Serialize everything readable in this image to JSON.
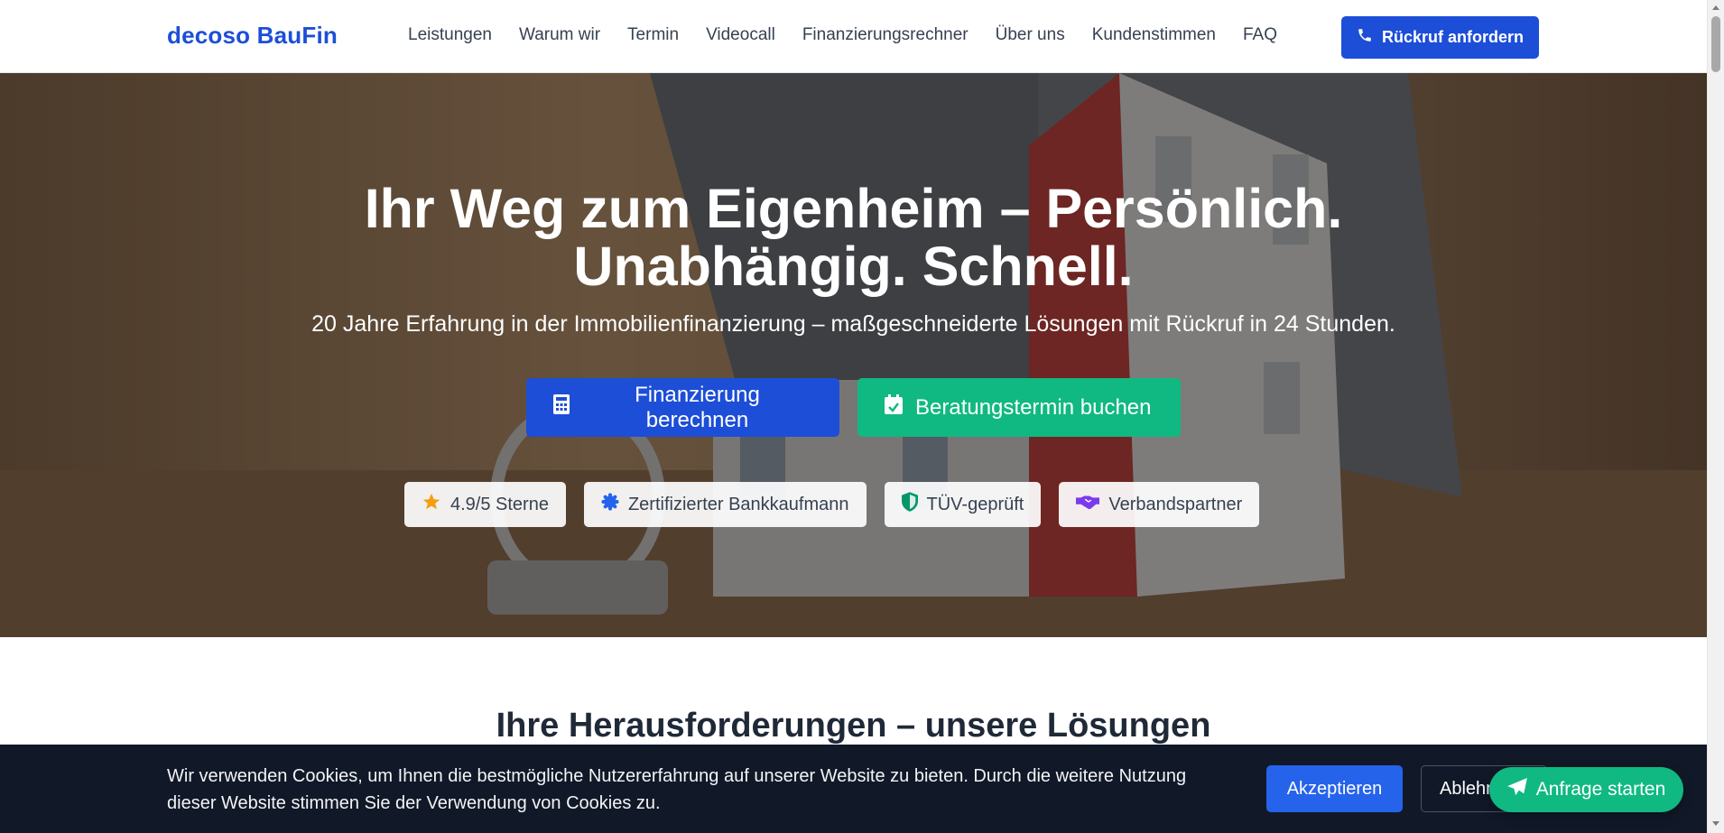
{
  "header": {
    "logo": "decoso BauFin",
    "nav": [
      "Leistungen",
      "Warum wir",
      "Termin",
      "Videocall",
      "Finanzierungsrechner",
      "Über uns",
      "Kundenstimmen",
      "FAQ"
    ],
    "callback_label": "Rückruf anfordern",
    "callback_icon": "phone-icon"
  },
  "hero": {
    "title_line1": "Ihr Weg zum Eigenheim – Persönlich.",
    "title_line2": "Unabhängig. Schnell.",
    "subtitle": "20 Jahre Erfahrung in der Immobilienfinanzierung – maßgeschneiderte Lösungen mit Rückruf in 24 Stunden.",
    "cta_calculate": "Finanzierung berechnen",
    "cta_appointment": "Beratungstermin buchen",
    "badges": [
      {
        "label": "4.9/5 Sterne",
        "icon": "star-icon",
        "color": "#f59e0b"
      },
      {
        "label": "Zertifizierter Bankkaufmann",
        "icon": "certificate-icon",
        "color": "#2563eb"
      },
      {
        "label": "TÜV-geprüft",
        "icon": "shield-icon",
        "color": "#059669"
      },
      {
        "label": "Verbandspartner",
        "icon": "handshake-icon",
        "color": "#7c3aed"
      }
    ]
  },
  "section": {
    "title": "Ihre Herausforderungen – unsere Lösungen"
  },
  "cookie": {
    "text": "Wir verwenden Cookies, um Ihnen die bestmögliche Nutzererfahrung auf unserer Website zu bieten. Durch die weitere Nutzung dieser Website stimmen Sie der Verwendung von Cookies zu.",
    "accept": "Akzeptieren",
    "decline": "Ablehnen"
  },
  "fab": {
    "label": "Anfrage starten",
    "icon": "paper-plane-icon"
  },
  "colors": {
    "primary": "#1d4ed8",
    "success": "#10b981",
    "dark": "#111827"
  }
}
